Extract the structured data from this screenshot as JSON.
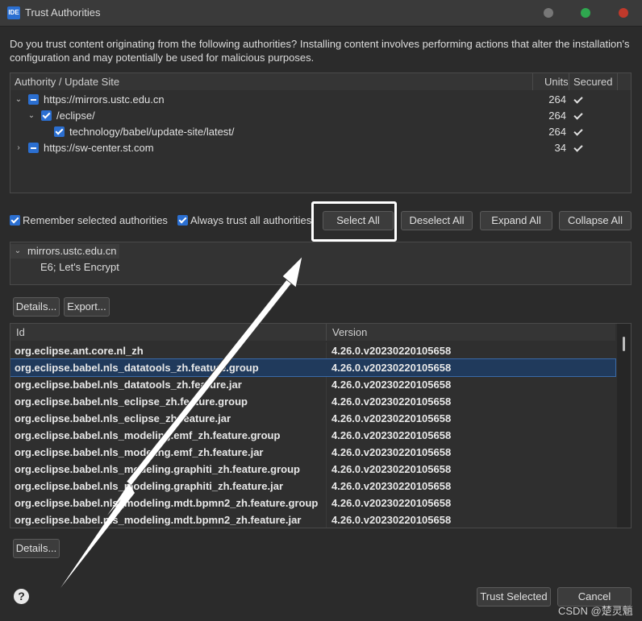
{
  "window": {
    "app_icon": "IDE",
    "title": "Trust Authorities",
    "controls": {
      "minimize_color": "#777777",
      "maximize_color": "#2fa84f",
      "close_color": "#c0392b"
    }
  },
  "intro": "Do you trust content originating from the following authorities?  Installing content involves performing actions that alter the installation's configuration and may potentially be used for malicious purposes.",
  "authorities": {
    "columns": {
      "site": "Authority / Update Site",
      "units": "Units",
      "secured": "Secured"
    },
    "rows": [
      {
        "label": "https://mirrors.ustc.edu.cn",
        "units": "264",
        "expanded": true,
        "check": "partial",
        "secured": true
      },
      {
        "label": "/eclipse/",
        "units": "264",
        "expanded": true,
        "check": "checked",
        "secured": true
      },
      {
        "label": "technology/babel/update-site/latest/",
        "units": "264",
        "check": "checked",
        "secured": true
      },
      {
        "label": "https://sw-center.st.com",
        "units": "34",
        "expanded": false,
        "check": "partial",
        "secured": true
      }
    ]
  },
  "options": {
    "remember_label": "Remember selected authorities",
    "always_trust_label": "Always trust all authorities"
  },
  "buttons": {
    "select_all": "Select All",
    "deselect_all": "Deselect All",
    "expand_all": "Expand All",
    "collapse_all": "Collapse All",
    "details": "Details...",
    "export": "Export...",
    "details2": "Details...",
    "trust_selected": "Trust Selected",
    "cancel": "Cancel"
  },
  "certificate": {
    "root": "mirrors.ustc.edu.cn",
    "child": "E6; Let's Encrypt"
  },
  "units_table": {
    "columns": {
      "id": "Id",
      "version": "Version"
    },
    "rows": [
      {
        "id": "org.eclipse.ant.core.nl_zh",
        "version": "4.26.0.v20230220105658"
      },
      {
        "id": "org.eclipse.babel.nls_datatools_zh.feature.group",
        "version": "4.26.0.v20230220105658",
        "selected": true
      },
      {
        "id": "org.eclipse.babel.nls_datatools_zh.feature.jar",
        "version": "4.26.0.v20230220105658"
      },
      {
        "id": "org.eclipse.babel.nls_eclipse_zh.feature.group",
        "version": "4.26.0.v20230220105658"
      },
      {
        "id": "org.eclipse.babel.nls_eclipse_zh.feature.jar",
        "version": "4.26.0.v20230220105658"
      },
      {
        "id": "org.eclipse.babel.nls_modeling.emf_zh.feature.group",
        "version": "4.26.0.v20230220105658"
      },
      {
        "id": "org.eclipse.babel.nls_modeling.emf_zh.feature.jar",
        "version": "4.26.0.v20230220105658"
      },
      {
        "id": "org.eclipse.babel.nls_modeling.graphiti_zh.feature.group",
        "version": "4.26.0.v20230220105658"
      },
      {
        "id": "org.eclipse.babel.nls_modeling.graphiti_zh.feature.jar",
        "version": "4.26.0.v20230220105658"
      },
      {
        "id": "org.eclipse.babel.nls_modeling.mdt.bpmn2_zh.feature.group",
        "version": "4.26.0.v20230220105658"
      },
      {
        "id": "org.eclipse.babel.nls_modeling.mdt.bpmn2_zh.feature.jar",
        "version": "4.26.0.v20230220105658"
      }
    ]
  },
  "watermark": "CSDN @楚灵魈",
  "help_glyph": "?"
}
